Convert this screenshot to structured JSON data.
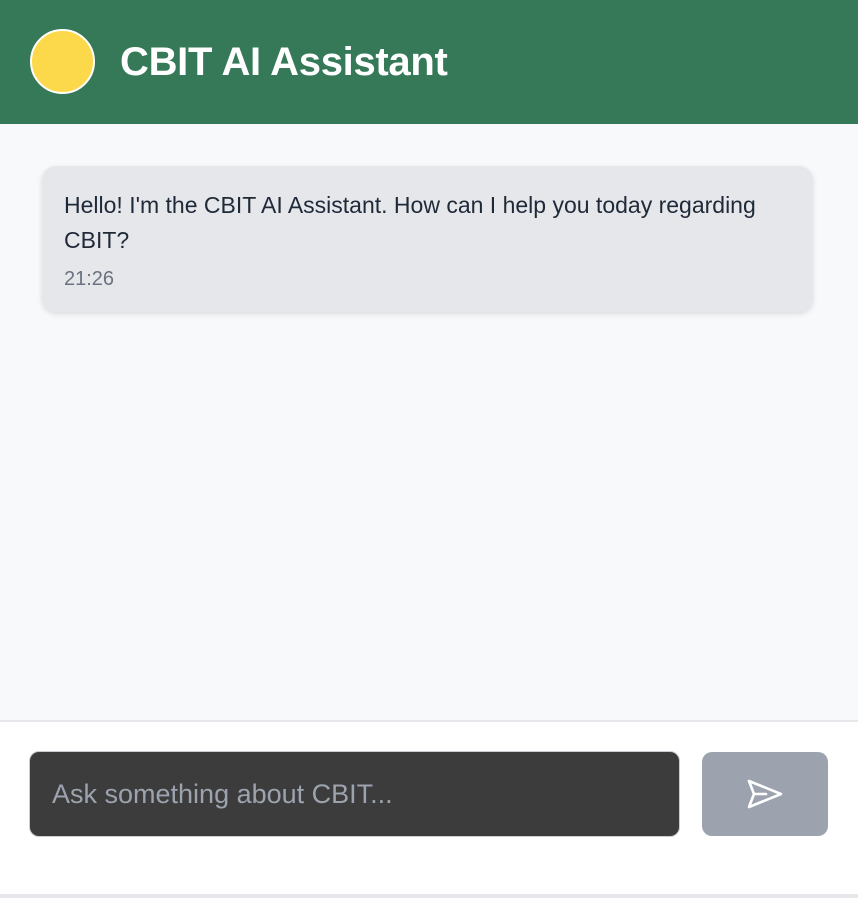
{
  "header": {
    "title": "CBIT AI Assistant",
    "avatar_color": "#fcd94a",
    "background_color": "#357959"
  },
  "messages": [
    {
      "sender": "assistant",
      "text": "Hello! I'm the CBIT AI Assistant. How can I help you today regarding CBIT?",
      "time": "21:26"
    }
  ],
  "composer": {
    "placeholder": "Ask something about CBIT...",
    "value": "",
    "send_icon": "send-icon"
  }
}
